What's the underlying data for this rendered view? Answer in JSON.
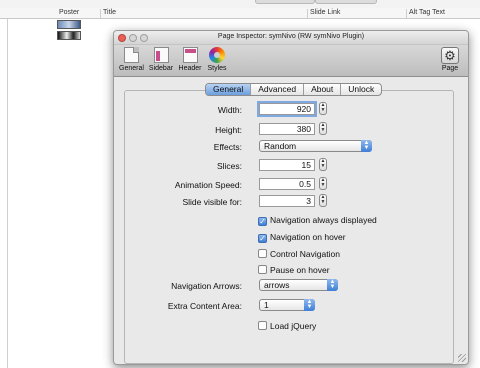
{
  "background_table": {
    "columns": {
      "poster": "Poster",
      "title": "Title",
      "slide_link": "Slide Link",
      "alt_tag_text": "Alt Tag Text"
    }
  },
  "window": {
    "title": "Page Inspector: symNivo (RW symNivo Plugin)",
    "toolbar": {
      "general": "General",
      "sidebar": "Sidebar",
      "header": "Header",
      "styles": "Styles",
      "page": "Page"
    }
  },
  "tabs": [
    "General",
    "Advanced",
    "About",
    "Unlock"
  ],
  "active_tab": "General",
  "form": {
    "width": {
      "label": "Width:",
      "value": "920"
    },
    "height": {
      "label": "Height:",
      "value": "380"
    },
    "effects": {
      "label": "Effects:",
      "value": "Random"
    },
    "slices": {
      "label": "Slices:",
      "value": "15"
    },
    "animation_speed": {
      "label": "Animation Speed:",
      "value": "0.5"
    },
    "slide_visible": {
      "label": "Slide visible for:",
      "value": "3"
    },
    "nav_always": {
      "label": "Navigation always displayed",
      "checked": true
    },
    "nav_hover": {
      "label": "Navigation on hover",
      "checked": true
    },
    "control_nav": {
      "label": "Control Navigation",
      "checked": false
    },
    "pause_hover": {
      "label": "Pause on hover",
      "checked": false
    },
    "nav_arrows": {
      "label": "Navigation Arrows:",
      "value": "arrows"
    },
    "extra_content": {
      "label": "Extra Content Area:",
      "value": "1"
    },
    "load_jquery": {
      "label": "Load jQuery",
      "checked": false
    }
  },
  "colors": {
    "accent": "#3f7fd6",
    "close": "#ec5f57",
    "minimize": "#d6d6d6",
    "zoom": "#d6d6d6"
  },
  "icons": {
    "general": "document-icon",
    "sidebar": "sidebar-layout-icon",
    "header": "header-layout-icon",
    "styles": "color-wheel-icon",
    "page": "gear-icon"
  }
}
